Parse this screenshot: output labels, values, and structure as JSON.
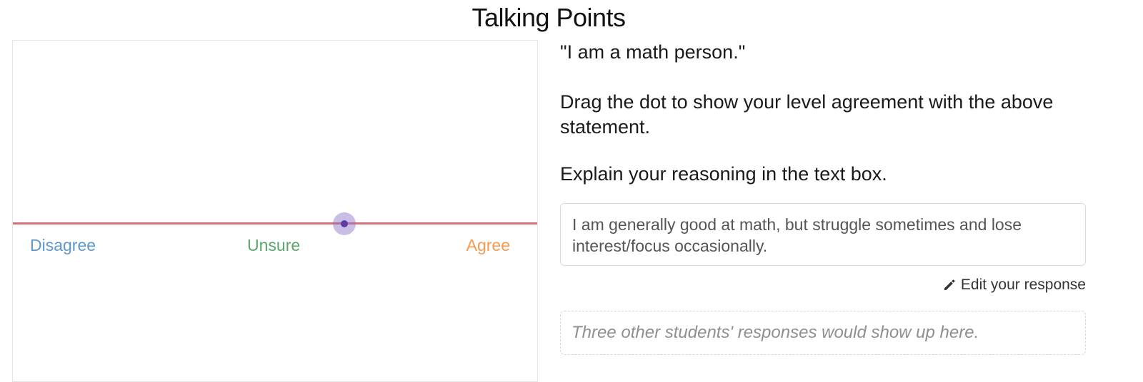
{
  "header": {
    "title": "Talking Points"
  },
  "slider": {
    "labels": {
      "disagree": "Disagree",
      "unsure": "Unsure",
      "agree": "Agree"
    },
    "label_colors": {
      "disagree": "#5f97cc",
      "unsure": "#5aa66b",
      "agree": "#f59a52"
    },
    "line_color": "#d4717a",
    "value": 0.63
  },
  "prompt": {
    "statement": "\"I am a math person.\"",
    "instruction": "Drag the dot to show your level agreement with the above statement.",
    "explain": "Explain your reasoning in the text box."
  },
  "response": {
    "text": "I am generally good at math, but struggle sometimes and lose interest/focus occasionally.",
    "edit_label": "Edit your response",
    "edit_icon": "pencil-icon"
  },
  "others": {
    "placeholder": "Three other students' responses would show up here."
  }
}
